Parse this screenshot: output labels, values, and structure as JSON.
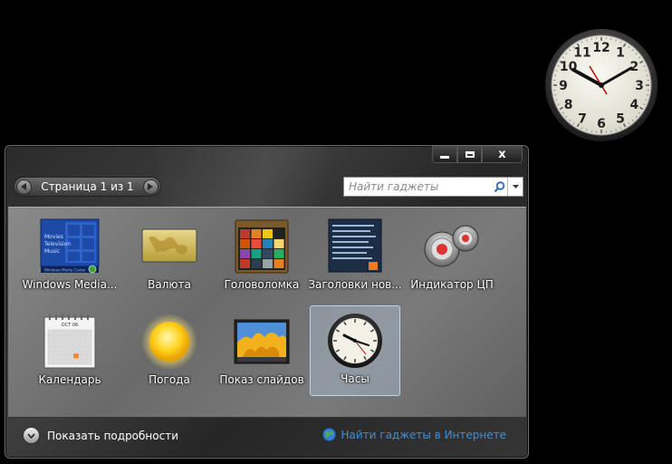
{
  "desktop": {
    "clock": {
      "numerals": [
        "12",
        "1",
        "2",
        "3",
        "4",
        "5",
        "6",
        "7",
        "8",
        "9",
        "10",
        "11"
      ]
    }
  },
  "window": {
    "caption": {
      "close_label": "x"
    },
    "pager": {
      "label": "Страница 1 из 1"
    },
    "search": {
      "placeholder": "Найти гаджеты"
    },
    "gadgets": [
      {
        "label": "Windows Media...",
        "icon": "media-center-icon"
      },
      {
        "label": "Валюта",
        "icon": "currency-icon"
      },
      {
        "label": "Головоломка",
        "icon": "puzzle-icon"
      },
      {
        "label": "Заголовки нов...",
        "icon": "feed-headlines-icon"
      },
      {
        "label": "Индикатор ЦП",
        "icon": "cpu-meter-icon"
      },
      {
        "label": "Календарь",
        "icon": "calendar-icon"
      },
      {
        "label": "Погода",
        "icon": "weather-sun-icon"
      },
      {
        "label": "Показ слайдов",
        "icon": "slideshow-icon"
      },
      {
        "label": "Часы",
        "icon": "clock-icon",
        "selected": true
      }
    ],
    "media_thumb": {
      "lines": [
        "Movies",
        "Television",
        "Music"
      ],
      "footer": "Windows Media Center"
    },
    "calendar_thumb": {
      "month": "OCT 06"
    },
    "footer": {
      "details_label": "Показать подробности",
      "online_label": "Найти гаджеты в Интернете"
    },
    "colors": {
      "accent_link": "#3f8fd6",
      "selection": "#b8d4ef"
    }
  }
}
